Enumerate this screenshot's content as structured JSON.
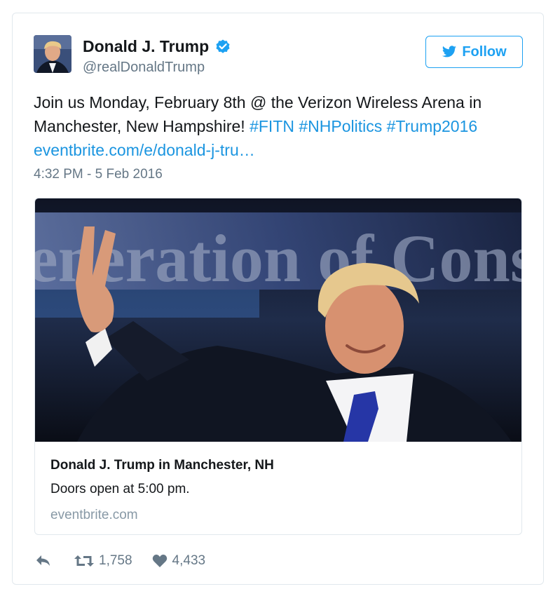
{
  "user": {
    "display_name": "Donald J. Trump",
    "handle": "@realDonaldTrump",
    "verified": true,
    "avatar_icon": "profile-photo"
  },
  "follow_button": {
    "label": "Follow",
    "icon": "twitter-bird-icon"
  },
  "tweet": {
    "text_plain": "Join us Monday, February 8th @ the Verizon Wireless Arena in Manchester, New Hampshire! ",
    "hashtags": [
      "#FITN",
      "#NHPolitics",
      "#Trump2016"
    ],
    "link": "eventbrite.com/e/donald-j-tru…",
    "timestamp": "4:32 PM - 5 Feb 2016"
  },
  "card": {
    "image_banner_text": "eneration of Conse",
    "title": "Donald J. Trump in Manchester, NH",
    "description": "Doors open at 5:00 pm.",
    "domain": "eventbrite.com"
  },
  "actions": {
    "reply_icon": "reply-icon",
    "retweet_icon": "retweet-icon",
    "retweet_count": "1,758",
    "like_icon": "heart-icon",
    "like_count": "4,433"
  },
  "colors": {
    "accent": "#1da1f2",
    "link": "#1b95e0",
    "secondary_text": "#657786",
    "border": "#e1e8ed"
  }
}
